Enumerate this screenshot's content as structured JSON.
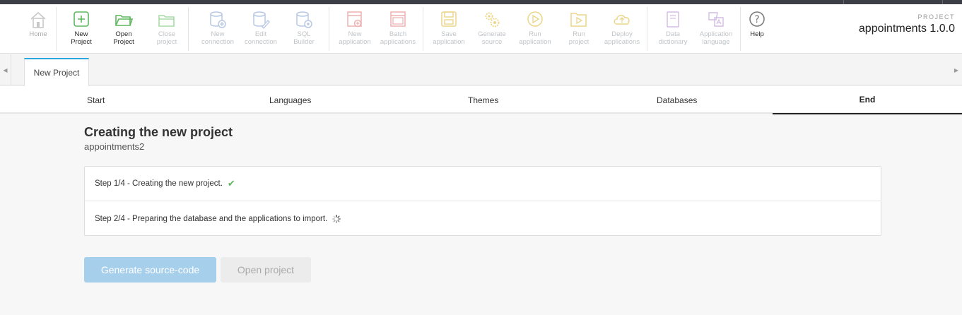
{
  "toolbar": {
    "items": [
      {
        "label": "Home",
        "icon": "home-icon"
      },
      {
        "label": "New\nProject",
        "icon": "plus-square-icon"
      },
      {
        "label": "Open\nProject",
        "icon": "folder-open-icon"
      },
      {
        "label": "Close\nproject",
        "icon": "folder-close-icon"
      },
      {
        "label": "New\nconnection",
        "icon": "db-plus-icon"
      },
      {
        "label": "Edit\nconnection",
        "icon": "db-edit-icon"
      },
      {
        "label": "SQL\nBuilder",
        "icon": "db-gear-icon"
      },
      {
        "label": "New\napplication",
        "icon": "window-plus-icon"
      },
      {
        "label": "Batch\napplications",
        "icon": "windows-stack-icon"
      },
      {
        "label": "Save\napplication",
        "icon": "save-icon"
      },
      {
        "label": "Generate\nsource",
        "icon": "gears-icon"
      },
      {
        "label": "Run\napplication",
        "icon": "play-circle-icon"
      },
      {
        "label": "Run\nproject",
        "icon": "folder-play-icon"
      },
      {
        "label": "Deploy\napplications",
        "icon": "cloud-upload-icon"
      },
      {
        "label": "Data\ndictionary",
        "icon": "book-icon"
      },
      {
        "label": "Application\nlanguage",
        "icon": "language-icon"
      },
      {
        "label": "Help",
        "icon": "help-circle-icon"
      }
    ],
    "colors": {
      "green": "#5cb85c",
      "red": "#e88080",
      "yellow": "#e6c44c",
      "blue": "#8aaad6",
      "purple": "#c2a4d6"
    }
  },
  "project": {
    "caption": "PROJECT",
    "name": "appointments 1.0.0"
  },
  "tabs": {
    "document": "New Project"
  },
  "wizard": {
    "steps": [
      "Start",
      "Languages",
      "Themes",
      "Databases",
      "End"
    ],
    "active": "End"
  },
  "main": {
    "title": "Creating the new project",
    "project_name": "appointments2",
    "progress": [
      {
        "text": "Step 1/4 - Creating the new project.",
        "status": "done"
      },
      {
        "text": "Step 2/4 - Preparing the database and the applications to import.",
        "status": "loading"
      }
    ],
    "buttons": {
      "generate": "Generate source-code",
      "open": "Open project"
    }
  }
}
